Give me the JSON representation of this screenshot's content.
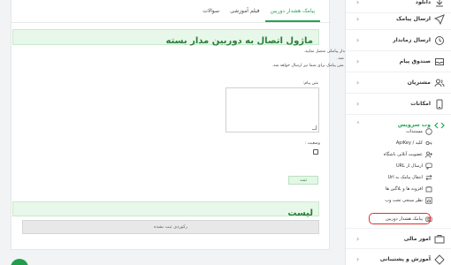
{
  "tabs": [
    {
      "label": "پیامک هشدار دوربین",
      "active": true
    },
    {
      "label": "فیلم آموزشی",
      "active": false
    },
    {
      "label": "سوالات",
      "active": false
    }
  ],
  "page_title": "ماژول اتصال به دوربین مدار بسته",
  "description": [
    "از این قسمت می توانید دوربین مدار بسته را به سیستم هشدار پیامکی متصل نمایید.",
    "متن پیام متنی است که در زمان اعلام هشدار، ارسال خواهد شد.",
    "می توانید پارامتر های خاصی نیز به URL اضافه نمایید که در متن پیامک برای شما نیز ارسال خواهد شد."
  ],
  "form": {
    "message_label": "متن پیام:",
    "message_value": "",
    "status_label": "وضعیت :",
    "status_checked": false,
    "submit_label": "ثبت"
  },
  "list": {
    "title": "لیست",
    "empty_text": "رکوردی ثبت نشده"
  },
  "sidebar": {
    "items": [
      {
        "label": "دانلود",
        "icon": "download-icon"
      },
      {
        "label": "ارسال پیامک",
        "icon": "send-icon"
      },
      {
        "label": "ارسال زماندار",
        "icon": "clock-icon"
      },
      {
        "label": "صندوق پیام",
        "icon": "inbox-icon"
      },
      {
        "label": "مشتریان",
        "icon": "users-icon"
      },
      {
        "label": "امکانات",
        "icon": "phone-icon"
      },
      {
        "label": "وب سرویس",
        "icon": "code-icon",
        "active": true
      }
    ],
    "sub_items": [
      {
        "label": "مستندات",
        "icon": "github-icon"
      },
      {
        "label": "کلید / ApiKey",
        "icon": "key-icon"
      },
      {
        "label": "عضویت آنلاین باشگاه",
        "icon": "user-plus-icon"
      },
      {
        "label": "ارسال از URL",
        "icon": "chat-icon"
      },
      {
        "label": "انتقال پیامک به Url",
        "icon": "transfer-icon"
      },
      {
        "label": "افزونه ها و پلاگین ها",
        "icon": "plugin-icon"
      },
      {
        "label": "نظر سنجی تحت وب",
        "icon": "poll-icon"
      },
      {
        "label": "پیامک هشدار دوربین",
        "icon": "camera-icon",
        "highlighted": true
      }
    ],
    "bottom_items": [
      {
        "label": "امور مالی",
        "icon": "finance-icon"
      },
      {
        "label": "آموزش و پشتیبانی",
        "icon": "support-icon"
      }
    ]
  },
  "colors": {
    "accent_green": "#23a455",
    "highlight_red": "#e0312f"
  }
}
